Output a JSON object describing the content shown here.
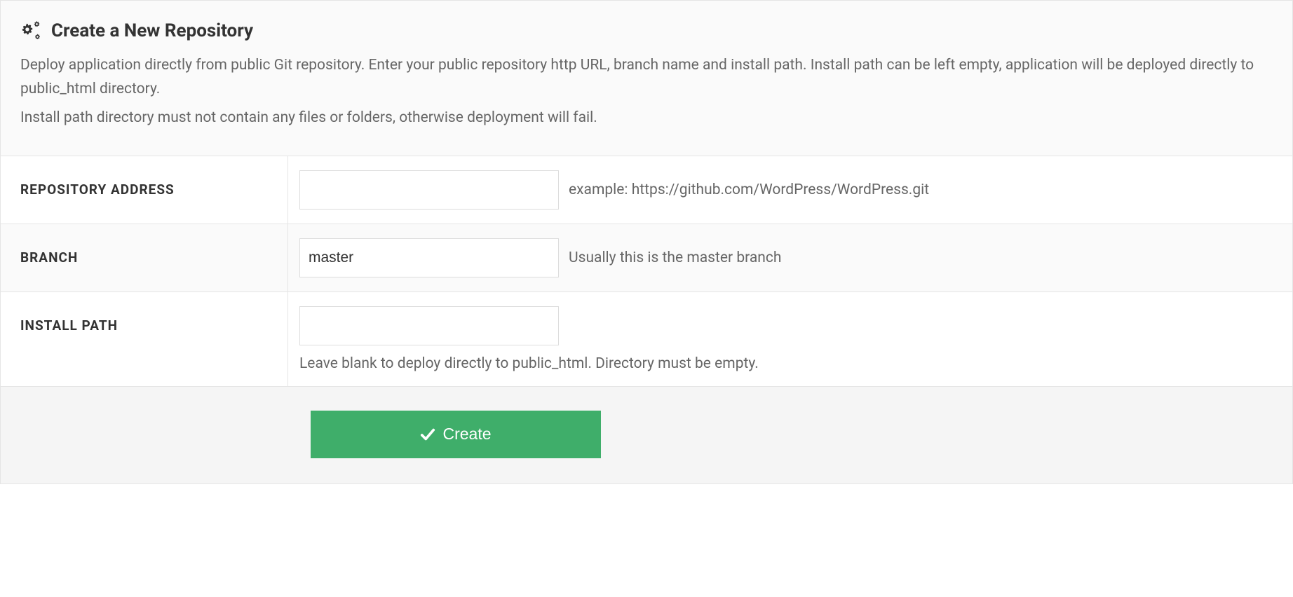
{
  "panel": {
    "title": "Create a New Repository",
    "desc1": "Deploy application directly from public Git repository. Enter your public repository http URL, branch name and install path. Install path can be left empty, application will be deployed directly to public_html directory.",
    "desc2": "Install path directory must not contain any files or folders, otherwise deployment will fail."
  },
  "form": {
    "repo": {
      "label": "REPOSITORY ADDRESS",
      "value": "",
      "hint": "example: https://github.com/WordPress/WordPress.git"
    },
    "branch": {
      "label": "BRANCH",
      "value": "master",
      "hint": "Usually this is the master branch"
    },
    "install_path": {
      "label": "INSTALL PATH",
      "value": "",
      "hint_below": "Leave blank to deploy directly to public_html. Directory must be empty."
    }
  },
  "actions": {
    "create_label": "Create"
  }
}
